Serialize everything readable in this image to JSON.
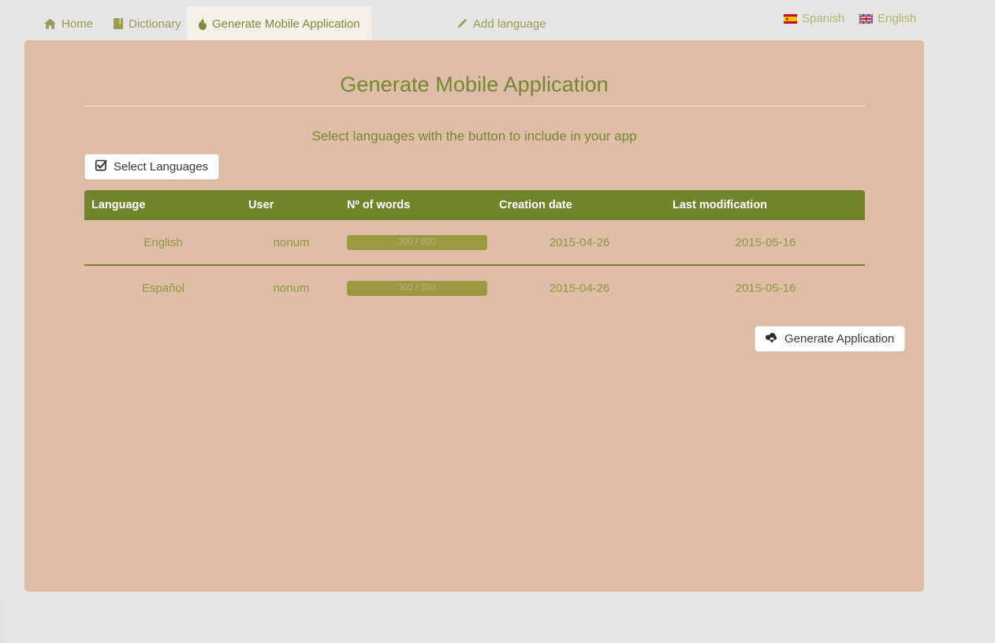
{
  "navbar": {
    "tabs": [
      {
        "label": "Home",
        "icon": "home-icon",
        "active": false
      },
      {
        "label": "Dictionary",
        "icon": "book-icon",
        "active": false
      },
      {
        "label": "Generate Mobile Application",
        "icon": "fire-icon",
        "active": true
      },
      {
        "label": "Add language",
        "icon": "pencil-icon",
        "active": false
      }
    ],
    "languages": [
      {
        "label": "Spanish",
        "icon": "spain-flag-icon"
      },
      {
        "label": "English",
        "icon": "uk-flag-icon"
      }
    ]
  },
  "page": {
    "title": "Generate Mobile Application",
    "subtitle": "Select languages with the button to include in your app"
  },
  "actions": {
    "select_languages": "Select Languages",
    "select_languages_icon": "check-square-icon",
    "generate_application": "Generate Application",
    "generate_application_icon": "cloud-download-icon"
  },
  "table": {
    "columns": [
      "Language",
      "User",
      "Nº of words",
      "Creation date",
      "Last modification"
    ],
    "rows": [
      {
        "language": "English",
        "user": "nonum",
        "words_label": "300 / 300",
        "words_current": 300,
        "words_total": 300,
        "percent": 100,
        "creation_date": "2015-04-26",
        "last_modification": "2015-05-16"
      },
      {
        "language": "Español",
        "user": "nonum",
        "words_label": "300 / 300",
        "words_current": 300,
        "words_total": 300,
        "percent": 100,
        "creation_date": "2015-04-26",
        "last_modification": "2015-05-16"
      }
    ]
  },
  "colors": {
    "page_background": "#e5e5e5",
    "panel_background": "#ddbda8",
    "accent_green": "#718429",
    "text_green": "#74892f",
    "nav_link": "#b5b56a",
    "active_tab_background": "#f4efe9",
    "progress_fill": "#9a9a42"
  }
}
